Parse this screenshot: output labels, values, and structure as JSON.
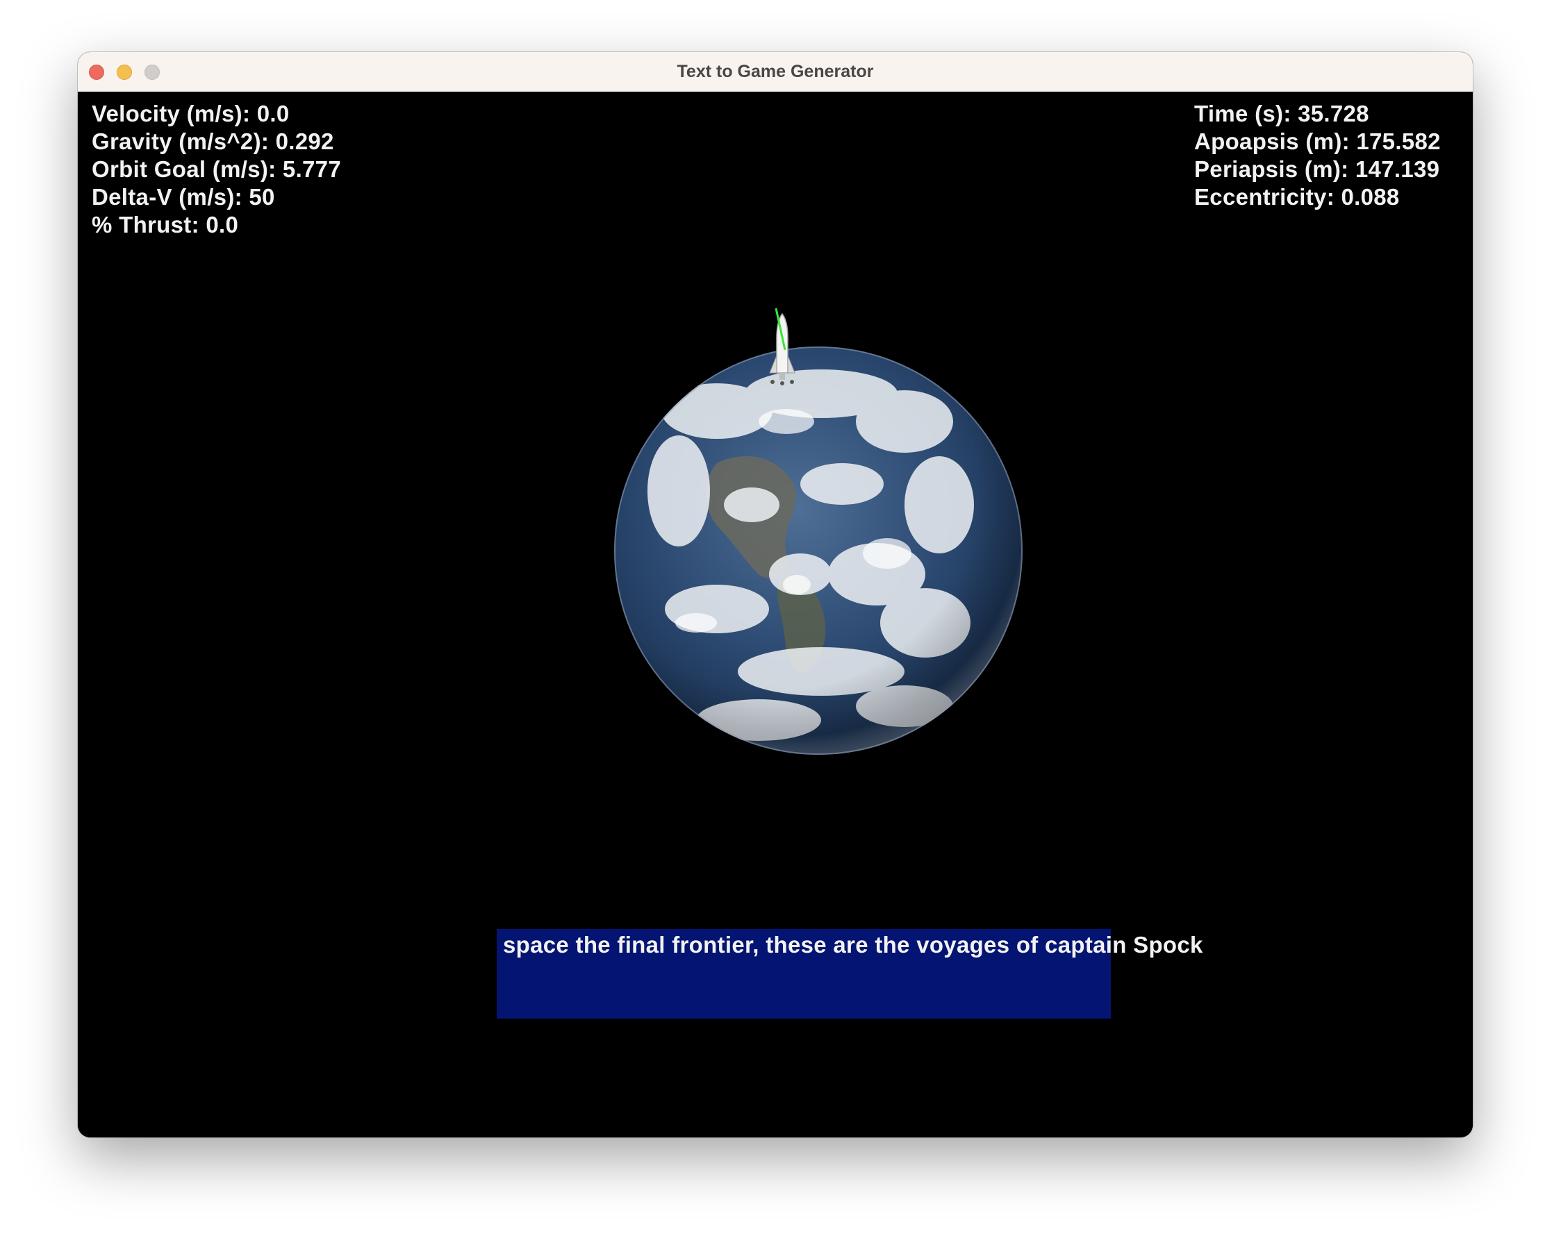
{
  "window": {
    "title": "Text to Game Generator"
  },
  "hud": {
    "left": [
      "Velocity (m/s): 0.0",
      "Gravity (m/s^2): 0.292",
      "Orbit Goal (m/s): 5.777",
      "Delta-V (m/s): 50",
      "% Thrust: 0.0"
    ],
    "right": [
      "Time (s): 35.728",
      "Apoapsis (m): 175.582",
      "Periapsis (m): 147.139",
      "Eccentricity: 0.088"
    ]
  },
  "dialog": {
    "text": "space the final frontier, these are the voyages of captain Spock"
  },
  "colors": {
    "background": "#000000",
    "dialog_box": "#031472",
    "hud_text": "#f2f2f2",
    "thrust_vector": "#39e639"
  },
  "icons": {
    "planet": "earth-icon",
    "ship": "rocket-icon"
  }
}
